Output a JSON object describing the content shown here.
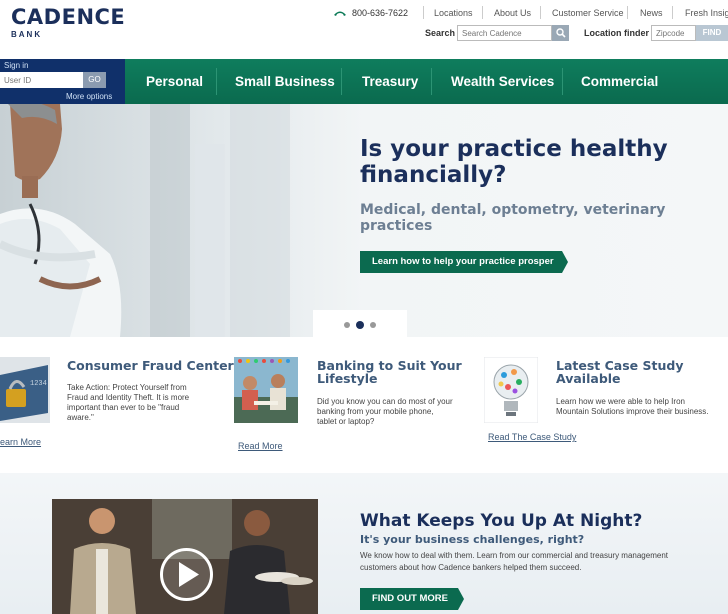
{
  "header": {
    "logo_word": "CADENCE",
    "logo_sub": "BANK",
    "phone": "800-636-7622",
    "links": [
      "Locations",
      "About Us",
      "Customer Service",
      "News",
      "Fresh Insigh"
    ],
    "search_label": "Search",
    "search_placeholder": "Search Cadence",
    "location_label": "Location finder",
    "zip_placeholder": "Zipcode",
    "find_label": "FIND"
  },
  "signin": {
    "label": "Sign in",
    "userid_placeholder": "User ID",
    "go_label": "GO",
    "more_options": "More options"
  },
  "nav": [
    "Personal",
    "Small Business",
    "Treasury",
    "Wealth Services",
    "Commercial"
  ],
  "hero": {
    "title_line1": "Is your practice healthy",
    "title_line2": "financially?",
    "subtitle_line1": "Medical, dental, optometry, veterinary",
    "subtitle_line2": "practices",
    "cta": "Learn how to help your practice prosper",
    "slides_total": 3,
    "slide_active": 2
  },
  "features": [
    {
      "title": "Consumer Fraud Center",
      "text_lines": [
        "Take Action: Protect Yourself from",
        "Fraud and Identity Theft. It is more",
        "important than ever to be \"fraud",
        "aware.\""
      ],
      "link": "earn More"
    },
    {
      "title_line1": "Banking to Suit Your",
      "title_line2": "Lifestyle",
      "text_lines": [
        "Did you know you can do most of your",
        "banking from your mobile phone,",
        "tablet or laptop?"
      ],
      "link": "Read More"
    },
    {
      "title_line1": "Latest Case Study",
      "title_line2": "Available",
      "text_lines": [
        "Learn how we were able to help Iron",
        "Mountain Solutions improve their business."
      ],
      "link": "Read The Case Study"
    }
  ],
  "bottom": {
    "title": "What Keeps You Up At Night?",
    "subtitle": "It's your business challenges, right?",
    "text_line1": "We know how to deal with them. Learn from our commercial and treasury management",
    "text_line2": "customers about how Cadence bankers helped them succeed.",
    "cta": "FIND OUT MORE"
  },
  "colors": {
    "brand_navy": "#1b2f5b",
    "brand_green": "#0b6a4f",
    "nav_green": "#0f7d5d",
    "link_blue": "#3e5a7a"
  }
}
